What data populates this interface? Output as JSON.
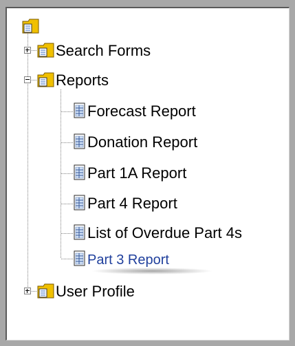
{
  "tree": {
    "items": [
      {
        "label": "Search Forms"
      },
      {
        "label": "Reports"
      },
      {
        "label": "Forecast Report"
      },
      {
        "label": "Donation Report"
      },
      {
        "label": "Part 1A Report"
      },
      {
        "label": "Part 4 Report"
      },
      {
        "label": "List of Overdue Part 4s"
      },
      {
        "label": "Part 3 Report"
      },
      {
        "label": "User Profile"
      }
    ],
    "selected": "Part 3 Report"
  },
  "icons": {
    "root": "folder-doc-icon",
    "folder": "folder-doc-icon",
    "document": "report-document-icon"
  },
  "colors": {
    "frame": "#a8a8a8",
    "selected_text": "#1f3f9c",
    "folder": "#f0c000"
  }
}
